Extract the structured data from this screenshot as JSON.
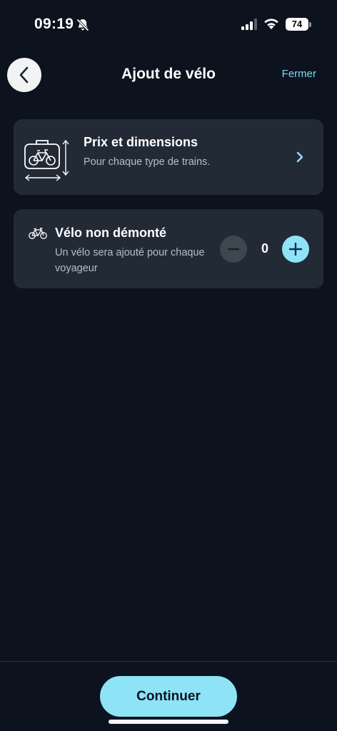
{
  "status_bar": {
    "time": "09:19",
    "battery": "74",
    "icons": [
      "bell-slash-icon",
      "cellular-signal-icon",
      "wifi-icon",
      "battery-icon"
    ]
  },
  "header": {
    "title": "Ajout de vélo",
    "close_label": "Fermer",
    "back_icon": "chevron-left-icon"
  },
  "info_card": {
    "title": "Prix et dimensions",
    "subtitle": "Pour chaque type de trains.",
    "icon": "bike-case-dimensions-icon",
    "chevron_icon": "chevron-right-icon"
  },
  "bike_option": {
    "title": "Vélo non démonté",
    "description": "Un vélo sera ajouté pour chaque voyageur",
    "icon": "bicycle-icon",
    "count": "0"
  },
  "footer": {
    "continue_label": "Continuer"
  },
  "colors": {
    "background": "#0c131f",
    "card": "#222a36",
    "accent": "#8fe3f7",
    "link": "#7fd8f2"
  }
}
